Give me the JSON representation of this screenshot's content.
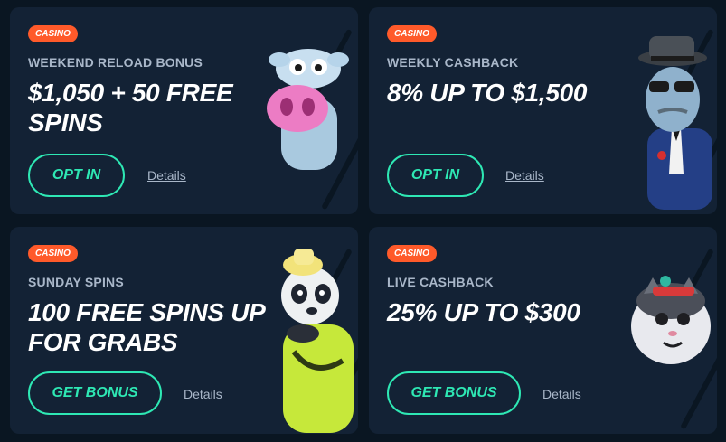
{
  "cards": [
    {
      "badge": "CASINO",
      "subtitle": "WEEKEND RELOAD BONUS",
      "headline": "$1,050 + 50 FREE SPINS",
      "button": "OPT IN",
      "details": "Details",
      "art": "cow-mascot"
    },
    {
      "badge": "CASINO",
      "subtitle": "WEEKLY CASHBACK",
      "headline": "8% UP TO $1,500",
      "button": "OPT IN",
      "details": "Details",
      "art": "gangster-mascot"
    },
    {
      "badge": "CASINO",
      "subtitle": "SUNDAY SPINS",
      "headline": "100 FREE SPINS UP FOR GRABS",
      "button": "GET BONUS",
      "details": "Details",
      "art": "panda-mascot"
    },
    {
      "badge": "CASINO",
      "subtitle": "LIVE CASHBACK",
      "headline": "25% UP TO $300",
      "button": "GET BONUS",
      "details": "Details",
      "art": "cat-mascot"
    }
  ],
  "colors": {
    "page_bg": "#0a1622",
    "card_bg": "#132235",
    "badge": "#ff5a2a",
    "accent": "#2ee8b4",
    "muted_text": "#a9b7c9"
  }
}
